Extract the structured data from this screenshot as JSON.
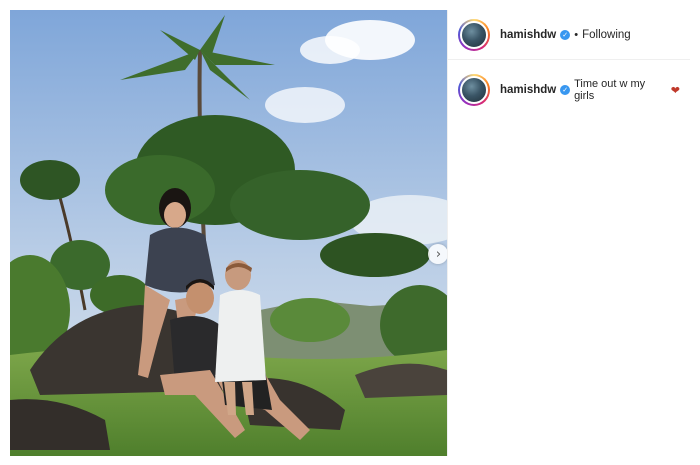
{
  "post": {
    "username": "hamishdw",
    "verified_glyph": "✓",
    "separator": "•",
    "follow_status": "Following",
    "caption": "Time out w my girls",
    "caption_emoji": "❤",
    "next_glyph": "›"
  },
  "icons": [
    "verified-badge-icon",
    "chevron-right-icon",
    "heart-emoji-icon"
  ],
  "colors": {
    "verified": "#3897f0",
    "text": "#262626",
    "divider": "#efefef"
  }
}
